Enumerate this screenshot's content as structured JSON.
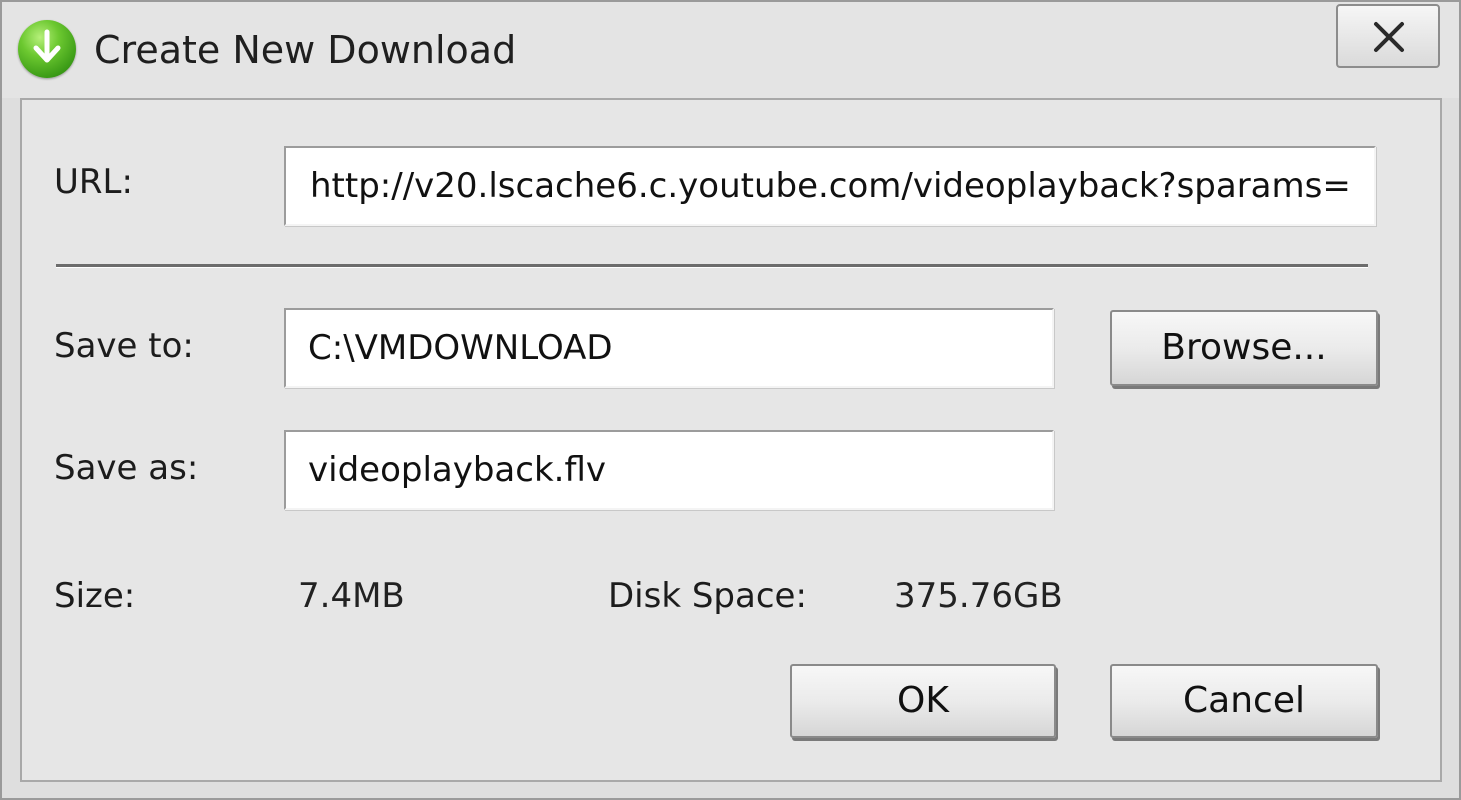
{
  "window": {
    "title": "Create New Download",
    "close_glyph": "✕"
  },
  "form": {
    "url_label": "URL:",
    "url_value": "http://v20.lscache6.c.youtube.com/videoplayback?sparams=",
    "save_to_label": "Save to:",
    "save_to_value": "C:\\VMDOWNLOAD",
    "save_as_label": "Save as:",
    "save_as_value": "videoplayback.flv",
    "browse_label": "Browse..."
  },
  "info": {
    "size_label": "Size:",
    "size_value": "7.4MB",
    "disk_space_label": "Disk Space:",
    "disk_space_value": "375.76GB"
  },
  "actions": {
    "ok_label": "OK",
    "cancel_label": "Cancel"
  },
  "icons": {
    "app": "download-arrow-icon",
    "close": "close-icon"
  },
  "colors": {
    "app_icon_green": "#3a9a16",
    "window_bg": "#dedede"
  }
}
